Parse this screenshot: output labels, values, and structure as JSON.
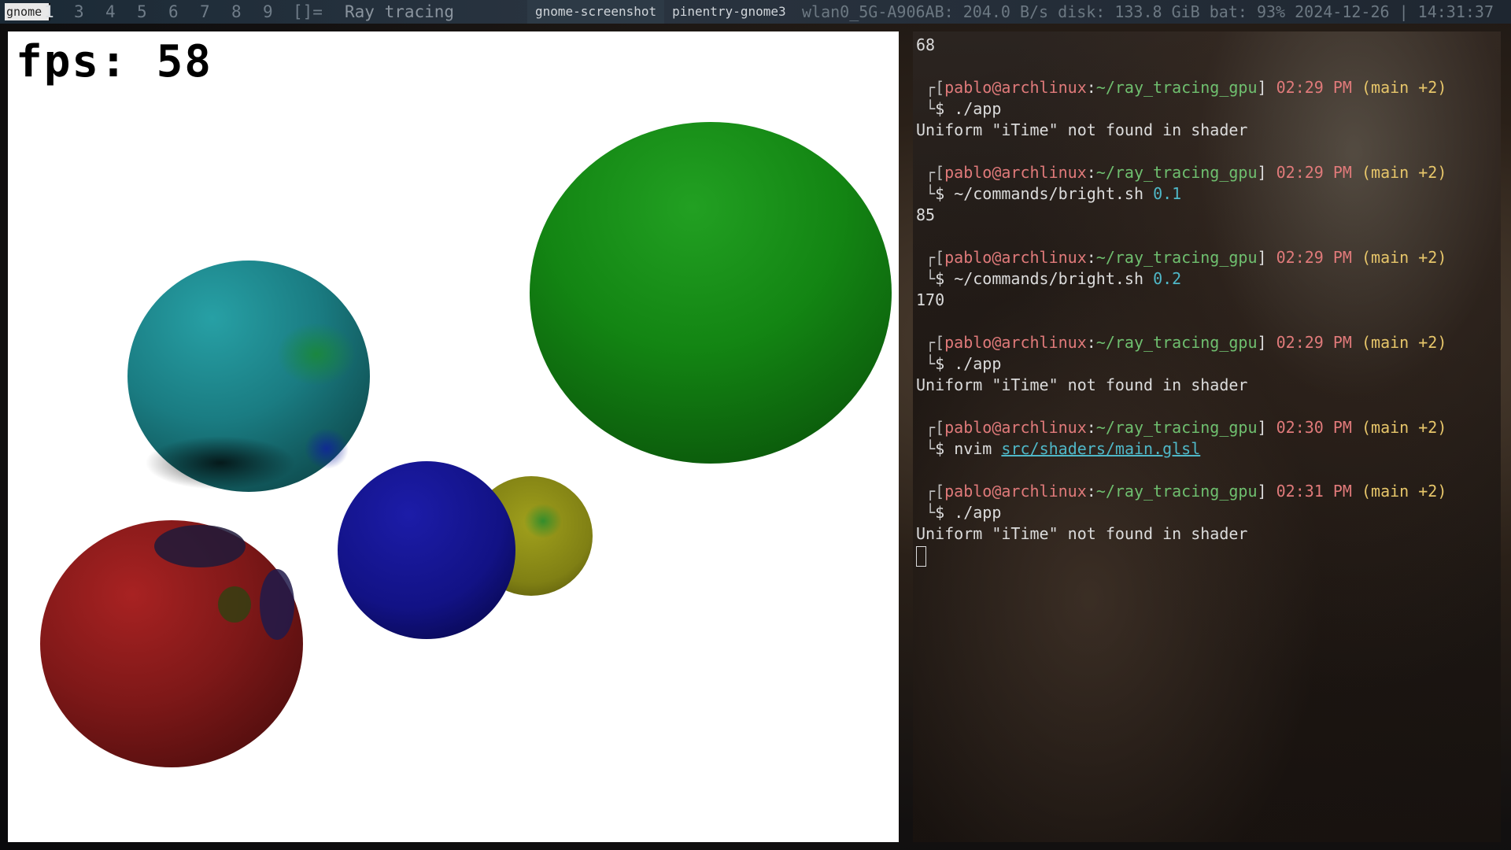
{
  "topbar": {
    "prompt_value": "gnome",
    "workspaces": [
      "1",
      "3",
      "4",
      "5",
      "6",
      "7",
      "8",
      "9"
    ],
    "layout_symbol": "[]=",
    "window_title": "Ray tracing",
    "tasks": [
      "gnome-screenshot",
      "pinentry-gnome3"
    ],
    "status": "wlan0_5G-A906AB: 204.0 B/s   disk: 133.8 GiB  bat: 93%   2024-12-26 | 14:31:37"
  },
  "raywindow": {
    "fps_label": "fps: 58",
    "spheres": [
      {
        "name": "green",
        "color": "#1a8a1a"
      },
      {
        "name": "teal",
        "color": "#1f8a8f"
      },
      {
        "name": "blue",
        "color": "#16168e"
      },
      {
        "name": "yellow",
        "color": "#8f8f16"
      },
      {
        "name": "red",
        "color": "#8a1a1a"
      }
    ]
  },
  "terminal": {
    "lines": [
      {
        "type": "output",
        "text": "68"
      },
      {
        "type": "blank"
      },
      {
        "type": "prompt",
        "user": "pablo@archlinux",
        "path": "~/ray_tracing_gpu",
        "time": "02:29 PM",
        "branch": "(main +2)"
      },
      {
        "type": "cmd",
        "cmd": "./app",
        "arg": ""
      },
      {
        "type": "output",
        "text": "Uniform \"iTime\" not found in shader"
      },
      {
        "type": "blank"
      },
      {
        "type": "prompt",
        "user": "pablo@archlinux",
        "path": "~/ray_tracing_gpu",
        "time": "02:29 PM",
        "branch": "(main +2)"
      },
      {
        "type": "cmd",
        "cmd": "~/commands/bright.sh",
        "arg": "0.1"
      },
      {
        "type": "output",
        "text": "85"
      },
      {
        "type": "blank"
      },
      {
        "type": "prompt",
        "user": "pablo@archlinux",
        "path": "~/ray_tracing_gpu",
        "time": "02:29 PM",
        "branch": "(main +2)"
      },
      {
        "type": "cmd",
        "cmd": "~/commands/bright.sh",
        "arg": "0.2"
      },
      {
        "type": "output",
        "text": "170"
      },
      {
        "type": "blank"
      },
      {
        "type": "prompt",
        "user": "pablo@archlinux",
        "path": "~/ray_tracing_gpu",
        "time": "02:29 PM",
        "branch": "(main +2)"
      },
      {
        "type": "cmd",
        "cmd": "./app",
        "arg": ""
      },
      {
        "type": "output",
        "text": "Uniform \"iTime\" not found in shader"
      },
      {
        "type": "blank"
      },
      {
        "type": "prompt",
        "user": "pablo@archlinux",
        "path": "~/ray_tracing_gpu",
        "time": "02:30 PM",
        "branch": "(main +2)"
      },
      {
        "type": "cmd",
        "cmd": "nvim",
        "arg": "src/shaders/main.glsl",
        "link": true
      },
      {
        "type": "blank"
      },
      {
        "type": "prompt",
        "user": "pablo@archlinux",
        "path": "~/ray_tracing_gpu",
        "time": "02:31 PM",
        "branch": "(main +2)"
      },
      {
        "type": "cmd",
        "cmd": "./app",
        "arg": ""
      },
      {
        "type": "output",
        "text": "Uniform \"iTime\" not found in shader"
      },
      {
        "type": "cursor"
      }
    ]
  }
}
